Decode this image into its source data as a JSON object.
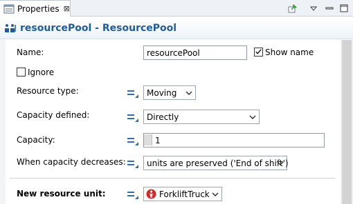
{
  "tab": {
    "label": "Properties",
    "close": "⊠",
    "icon": "properties-icon"
  },
  "toolbar": {
    "pin_icon": "pin-icon",
    "menu_icon": "view-menu-icon",
    "minimize_icon": "minimize-icon",
    "maximize_icon": "maximize-icon"
  },
  "header": {
    "title": "resourcePool - ResourcePool",
    "icon": "resource-pool-icon"
  },
  "form": {
    "name_label": "Name:",
    "name_value": "resourcePool",
    "show_name_label": "Show name",
    "show_name_checked": true,
    "ignore_label": "Ignore",
    "ignore_checked": false,
    "resource_type_label": "Resource type:",
    "resource_type_value": "Moving",
    "capacity_defined_label": "Capacity defined:",
    "capacity_defined_value": "Directly",
    "capacity_label": "Capacity:",
    "capacity_value": "1",
    "capacity_decreases_label": "When capacity decreases:",
    "capacity_decreases_value": "units are preserved ('End of shift')",
    "new_unit_label": "New resource unit:",
    "new_unit_value": "ForkliftTruck"
  },
  "colors": {
    "accent": "#1f5c9e",
    "equals_icon": "#2a6bc0",
    "unit_icon": "#d12b2b"
  }
}
